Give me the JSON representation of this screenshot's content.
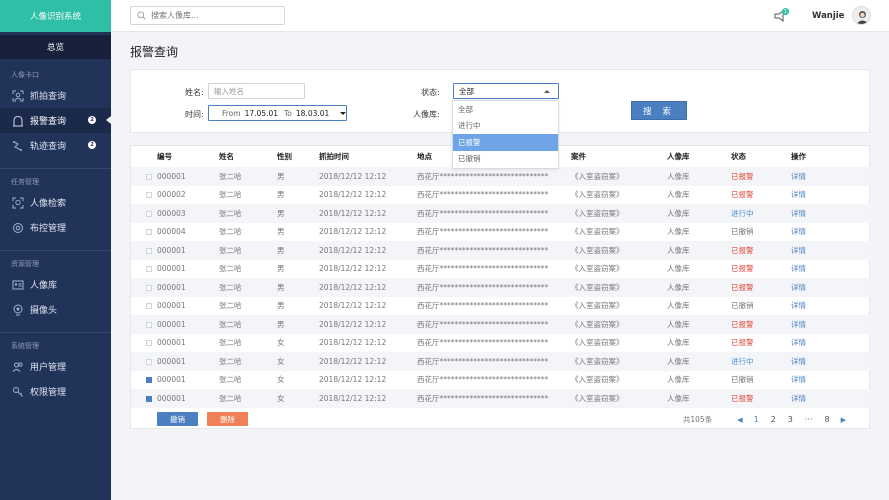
{
  "app_title": "人像识别系统",
  "sidebar": {
    "overview": "总览",
    "groups": [
      {
        "title": "人像卡口",
        "items": [
          {
            "label": "抓拍查询",
            "icon": "face-scan-icon"
          },
          {
            "label": "报警查询",
            "icon": "alarm-icon",
            "badge": "2",
            "active": true
          },
          {
            "label": "轨迹查询",
            "icon": "track-icon",
            "badge": "2"
          }
        ]
      },
      {
        "title": "任务管理",
        "items": [
          {
            "label": "人像检索",
            "icon": "face-search-icon"
          },
          {
            "label": "布控管理",
            "icon": "target-icon"
          }
        ]
      },
      {
        "title": "资源管理",
        "items": [
          {
            "label": "人像库",
            "icon": "id-card-icon"
          },
          {
            "label": "摄像头",
            "icon": "camera-icon"
          }
        ]
      },
      {
        "title": "系统管理",
        "items": [
          {
            "label": "用户管理",
            "icon": "users-icon"
          },
          {
            "label": "权限管理",
            "icon": "key-icon"
          }
        ]
      }
    ]
  },
  "header": {
    "search_placeholder": "搜索人像库...",
    "notification_count": "1",
    "username": "Wanjie"
  },
  "page": {
    "title": "报警查询"
  },
  "filter": {
    "name_label": "姓名:",
    "name_placeholder": "输入姓名",
    "time_label": "时间:",
    "from_label": "From",
    "from_value": "17.05.01",
    "to_label": "To",
    "to_value": "18.03.01",
    "status_label": "状态:",
    "status_value": "全部",
    "library_label": "人像库:",
    "search_button": "搜 索",
    "status_options": [
      "全部",
      "进行中",
      "已报警",
      "已撤销"
    ],
    "status_highlighted": "已报警"
  },
  "table": {
    "columns": [
      "编号",
      "姓名",
      "性别",
      "抓拍时间",
      "地点",
      "案件",
      "人像库",
      "状态",
      "操作"
    ],
    "rows": [
      {
        "checked": false,
        "id": "000001",
        "name": "张二哈",
        "gender": "男",
        "time": "2018/12/12 12:12",
        "place": "西花厅*****************************",
        "case": "《入室盗窃案》",
        "library": "人像库",
        "status": "已报警",
        "status_color": "#e04a3a",
        "op": "详情"
      },
      {
        "checked": false,
        "id": "000002",
        "name": "张二哈",
        "gender": "男",
        "time": "2018/12/12 12:12",
        "place": "西花厅*****************************",
        "case": "《入室盗窃案》",
        "library": "人像库",
        "status": "已报警",
        "status_color": "#e04a3a",
        "op": "详情"
      },
      {
        "checked": false,
        "id": "000003",
        "name": "张二哈",
        "gender": "男",
        "time": "2018/12/12 12:12",
        "place": "西花厅*****************************",
        "case": "《入室盗窃案》",
        "library": "人像库",
        "status": "进行中",
        "status_color": "#4a8fd8",
        "op": "详情"
      },
      {
        "checked": false,
        "id": "000004",
        "name": "张二哈",
        "gender": "男",
        "time": "2018/12/12 12:12",
        "place": "西花厅*****************************",
        "case": "《入室盗窃案》",
        "library": "人像库",
        "status": "已撤销",
        "status_color": "#777777",
        "op": "详情"
      },
      {
        "checked": false,
        "id": "000001",
        "name": "张二哈",
        "gender": "男",
        "time": "2018/12/12 12:12",
        "place": "西花厅*****************************",
        "case": "《入室盗窃案》",
        "library": "人像库",
        "status": "已报警",
        "status_color": "#e04a3a",
        "op": "详情"
      },
      {
        "checked": false,
        "id": "000001",
        "name": "张二哈",
        "gender": "男",
        "time": "2018/12/12 12:12",
        "place": "西花厅*****************************",
        "case": "《入室盗窃案》",
        "library": "人像库",
        "status": "已报警",
        "status_color": "#e04a3a",
        "op": "详情"
      },
      {
        "checked": false,
        "id": "000001",
        "name": "张二哈",
        "gender": "男",
        "time": "2018/12/12 12:12",
        "place": "西花厅*****************************",
        "case": "《入室盗窃案》",
        "library": "人像库",
        "status": "已报警",
        "status_color": "#e04a3a",
        "op": "详情"
      },
      {
        "checked": false,
        "id": "000001",
        "name": "张二哈",
        "gender": "男",
        "time": "2018/12/12 12:12",
        "place": "西花厅*****************************",
        "case": "《入室盗窃案》",
        "library": "人像库",
        "status": "已撤销",
        "status_color": "#777777",
        "op": "详情"
      },
      {
        "checked": false,
        "id": "000001",
        "name": "张二哈",
        "gender": "男",
        "time": "2018/12/12 12:12",
        "place": "西花厅*****************************",
        "case": "《入室盗窃案》",
        "library": "人像库",
        "status": "已报警",
        "status_color": "#e04a3a",
        "op": "详情"
      },
      {
        "checked": false,
        "id": "000001",
        "name": "张二哈",
        "gender": "女",
        "time": "2018/12/12 12:12",
        "place": "西花厅*****************************",
        "case": "《入室盗窃案》",
        "library": "人像库",
        "status": "已报警",
        "status_color": "#e04a3a",
        "op": "详情"
      },
      {
        "checked": false,
        "id": "000001",
        "name": "张二哈",
        "gender": "女",
        "time": "2018/12/12 12:12",
        "place": "西花厅*****************************",
        "case": "《入室盗窃案》",
        "library": "人像库",
        "status": "进行中",
        "status_color": "#4a8fd8",
        "op": "详情"
      },
      {
        "checked": true,
        "id": "000001",
        "name": "张二哈",
        "gender": "女",
        "time": "2018/12/12 12:12",
        "place": "西花厅*****************************",
        "case": "《入室盗窃案》",
        "library": "人像库",
        "status": "已撤销",
        "status_color": "#777777",
        "op": "详情"
      },
      {
        "checked": true,
        "id": "000001",
        "name": "张二哈",
        "gender": "女",
        "time": "2018/12/12 12:12",
        "place": "西花厅*****************************",
        "case": "《入室盗窃案》",
        "library": "人像库",
        "status": "已报警",
        "status_color": "#e04a3a",
        "op": "详情"
      }
    ]
  },
  "footer": {
    "cancel_button": "撤销",
    "delete_button": "删除",
    "total": "共105条",
    "pages": [
      "1",
      "2",
      "3",
      "···",
      "8"
    ],
    "current_page": "1"
  }
}
